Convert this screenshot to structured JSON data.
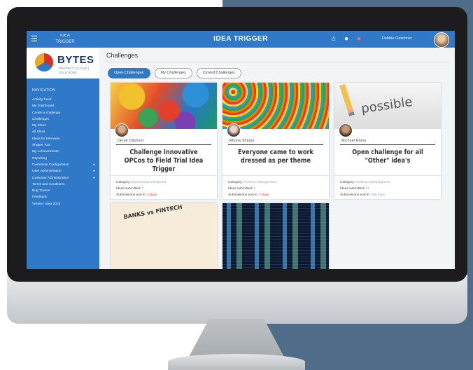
{
  "header": {
    "app_title": "IDEA TRIGGER",
    "brand_mini": "IDEA TRIGGER",
    "user_name": "Debbie Oeschner",
    "menu_icon": "hamburger-icon"
  },
  "sidebar": {
    "logo_text": "BYTES",
    "logo_sub": "PROTECT | CLOUD | SOLUTIONS",
    "heading": "NAVIGATION",
    "items": [
      {
        "label": "Activity Feed"
      },
      {
        "label": "My Dashboard"
      },
      {
        "label": "Create a challenge"
      },
      {
        "label": "Challenges"
      },
      {
        "label": "My Ideas"
      },
      {
        "label": "All Ideas"
      },
      {
        "label": "Ideas for Interview"
      },
      {
        "label": "Shaper Tool"
      },
      {
        "label": "My Achievements"
      },
      {
        "label": "Reporting"
      },
      {
        "label": "Customise Configuration",
        "caret": "▸"
      },
      {
        "label": "User Administration",
        "caret": "▸"
      },
      {
        "label": "Customer Administration",
        "caret": "▸"
      },
      {
        "label": "Terms and Conditions"
      },
      {
        "label": "Bug Tracker"
      },
      {
        "label": "Feedback"
      },
      {
        "label": "Version: Idea 2019"
      }
    ]
  },
  "main": {
    "page_title": "Challenges",
    "tabs": [
      {
        "label": "Open Challenges",
        "active": true
      },
      {
        "label": "My Challenges",
        "active": false
      },
      {
        "label": "Closed Challenges",
        "active": false
      }
    ],
    "cards": [
      {
        "owner": "Derek Oliphant",
        "title": "Challenge Innovative OPCos to Field Trial Idea Trigger",
        "category_label": "Category:",
        "category": "Business Development",
        "ideas_label": "Ideas submitted:",
        "ideas": "2",
        "ends_label": "Submissions end in:",
        "ends": "2 days"
      },
      {
        "owner": "Rhona Sharpe",
        "title": "Everyone came to work dressed as per theme",
        "category_label": "Category:",
        "category": "Process Management",
        "ideas_label": "Ideas submitted:",
        "ideas": "1",
        "ends_label": "Submissions end in:",
        "ends": "7 days"
      },
      {
        "owner": "Michael Raine",
        "title": "Open challenge for all \"Other\" idea's",
        "category_label": "Category:",
        "category": "Software Development",
        "ideas_label": "Ideas submitted:",
        "ideas": "11",
        "ends_label": "Submissions end in:",
        "ends": "365 days",
        "image_word": "possible"
      },
      {
        "image_word": "BANKS vs FINTECH"
      },
      {}
    ]
  },
  "colors": {
    "topbar": "#2f79c8",
    "sidebar": "#2f79c8",
    "accent_red": "#e03b2f",
    "background_panel": "#4f6c88"
  }
}
